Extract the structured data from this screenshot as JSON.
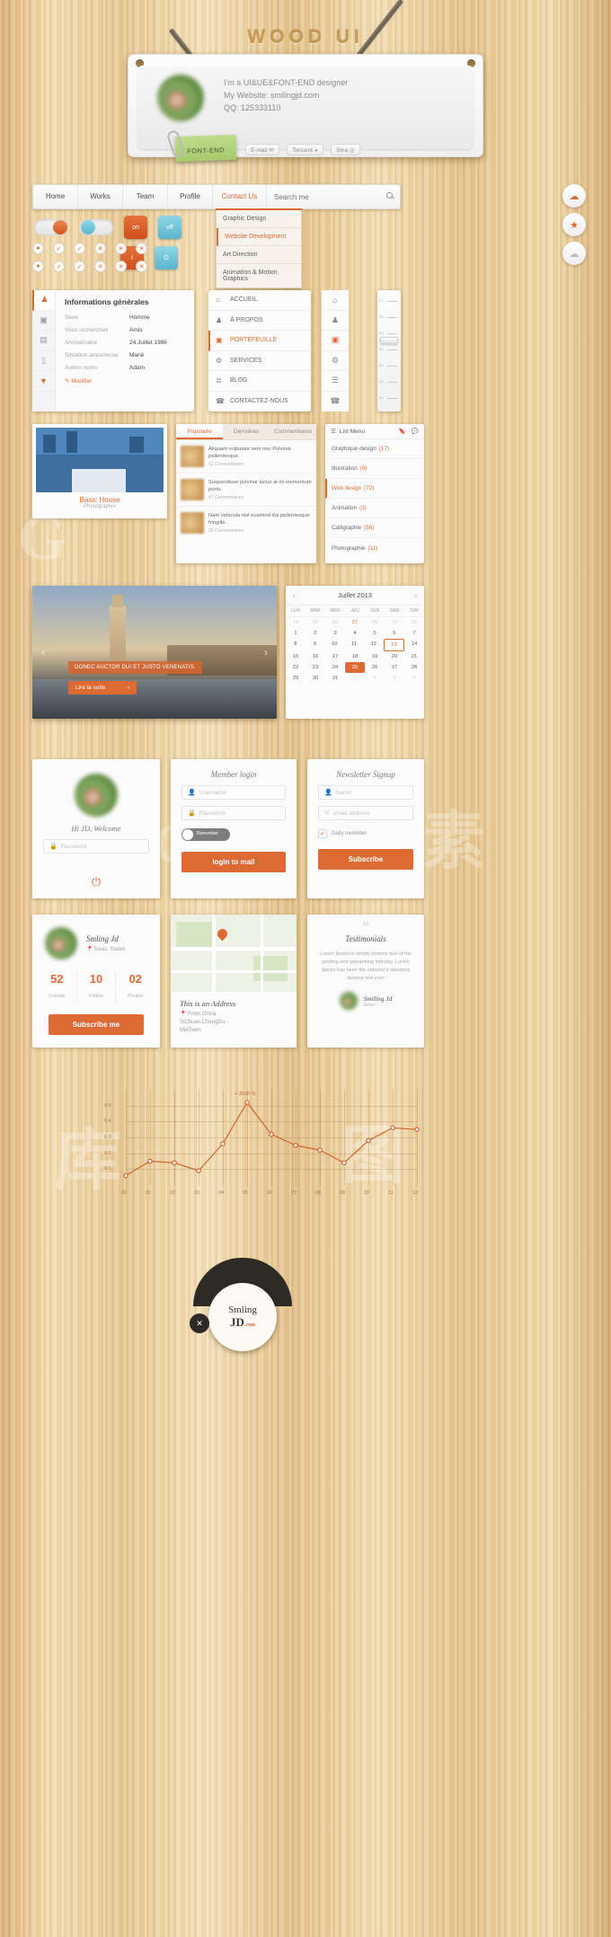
{
  "sign": {
    "wood_title": "WOOD UI",
    "lines": [
      "I'm a UI&UE&FONT-END designer",
      "My Website: smilingjd.com",
      "QQ: 125333110"
    ],
    "tag_label": "FONT-END",
    "buttons": [
      {
        "label": "E-mail",
        "icon": "mail-icon"
      },
      {
        "label": "Tencent",
        "icon": "penguin-icon"
      },
      {
        "label": "Sina",
        "icon": "weibo-icon"
      }
    ]
  },
  "nav": {
    "items": [
      {
        "label": "Home",
        "active": false
      },
      {
        "label": "Works",
        "active": false
      },
      {
        "label": "Team",
        "active": false
      },
      {
        "label": "Profile",
        "active": false
      },
      {
        "label": "Contact Us",
        "active": true
      }
    ],
    "search_placeholder": "Search me",
    "dropdown": [
      {
        "label": "Graphic Design",
        "active": false
      },
      {
        "label": "Website Development",
        "active": true
      },
      {
        "label": "Art Direction",
        "active": false
      },
      {
        "label": "Animation & Motion Graphics",
        "active": false
      }
    ]
  },
  "round_buttons": [
    {
      "icon": "cloud-upload-icon",
      "glyph": "☁"
    },
    {
      "icon": "star-icon",
      "glyph": "★"
    },
    {
      "icon": "cloud-icon",
      "glyph": "☁"
    }
  ],
  "toggles": [
    {
      "state": "on",
      "label": "on"
    },
    {
      "state": "off",
      "label": "off"
    }
  ],
  "square_buttons": [
    {
      "label": "on",
      "color": "#dd5a28"
    },
    {
      "label": "off",
      "color": "#6ec5d8"
    },
    {
      "label": "I",
      "color": "#dd5a28"
    },
    {
      "label": "O",
      "color": "#6ec5d8"
    }
  ],
  "check_grid": [
    [
      "●",
      "✓",
      "✓",
      "✕",
      "✕",
      "✕"
    ],
    [
      "●",
      "✓",
      "✓",
      "✕",
      "✕",
      "✕"
    ]
  ],
  "info_panel": {
    "title": "Informations générales",
    "rows": [
      {
        "key": "Sexe",
        "value": "Homme"
      },
      {
        "key": "Vous recherchez",
        "value": "Amis"
      },
      {
        "key": "Anniversaire",
        "value": "24 Juillet 1986"
      },
      {
        "key": "Situation amoureuse",
        "value": "Marié"
      },
      {
        "key": "Autres noms",
        "value": "Adam"
      }
    ],
    "edit_label": "Modifier",
    "rail_icons": [
      "users-icon",
      "image-icon",
      "film-icon",
      "document-icon",
      "download-icon"
    ]
  },
  "vertical_menu": {
    "items": [
      {
        "label": "ACCUEIL",
        "icon": "home-icon",
        "glyph": "⌂",
        "active": false
      },
      {
        "label": "À PROPOS",
        "icon": "users-icon",
        "glyph": "♟",
        "active": false
      },
      {
        "label": "PORTEFEUILLE",
        "icon": "briefcase-icon",
        "glyph": "▣",
        "active": true
      },
      {
        "label": "SERVICES",
        "icon": "gear-icon",
        "glyph": "⚙",
        "active": false
      },
      {
        "label": "BLOG",
        "icon": "list-icon",
        "glyph": "≣",
        "active": false
      },
      {
        "label": "CONTACTEZ-NOUS",
        "icon": "phone-icon",
        "glyph": "☎",
        "active": false
      }
    ],
    "side_icons": [
      "home-icon",
      "users-icon",
      "briefcase-icon",
      "gear-icon",
      "list-icon",
      "phone-icon"
    ]
  },
  "ruler": {
    "labels": [
      "07",
      "06",
      "05",
      "04",
      "03",
      "02",
      "01"
    ],
    "knob_position": 52
  },
  "photo_card": {
    "title": "Basic House",
    "subtitle": "Photographie"
  },
  "tabs_panel": {
    "tabs": [
      {
        "label": "Populaire",
        "active": true
      },
      {
        "label": "Dernières",
        "active": false
      },
      {
        "label": "Commentaires",
        "active": false
      }
    ],
    "posts": [
      {
        "text": "Aliquam vulputate sem nec Pulvinar pellentesque.",
        "comments": "52 Commentaires"
      },
      {
        "text": "Suspendisse pulvinar lacus at mi elementum porta.",
        "comments": "47 Commentaires"
      },
      {
        "text": "Nam vehicula nisl euismod dui pellentesque fringilla.",
        "comments": "38 Commentaires"
      }
    ]
  },
  "list_menu": {
    "header": "List Menu",
    "header_icons": [
      "bookmark-icon",
      "comment-icon"
    ],
    "items": [
      {
        "label": "Graphique design",
        "count": "(17)",
        "active": false
      },
      {
        "label": "Illustration",
        "count": "(9)",
        "active": false
      },
      {
        "label": "Web design",
        "count": "(72)",
        "active": true
      },
      {
        "label": "Animation",
        "count": "(3)",
        "active": false
      },
      {
        "label": "Calligraphie",
        "count": "(56)",
        "active": false
      },
      {
        "label": "Photographie",
        "count": "(11)",
        "active": false
      }
    ]
  },
  "banner": {
    "caption": "DONEC AUCTOR DUI ET JUSTO VENENATIS.",
    "button": "Lire la suite",
    "prev": "‹",
    "next": "›"
  },
  "calendar": {
    "month": "Juillet 2013",
    "prev": "‹",
    "next": "›",
    "dow": [
      "LUN",
      "MAR",
      "MER",
      "JEU",
      "VEN",
      "SAM",
      "DIM"
    ],
    "weeks": [
      [
        {
          "d": "24",
          "s": "mut"
        },
        {
          "d": "25",
          "s": "mut"
        },
        {
          "d": "26",
          "s": "mut"
        },
        {
          "d": "27",
          "s": "orng"
        },
        {
          "d": "28",
          "s": "mut"
        },
        {
          "d": "29",
          "s": "mut"
        },
        {
          "d": "30",
          "s": "mut"
        }
      ],
      [
        {
          "d": "1",
          "s": ""
        },
        {
          "d": "2",
          "s": ""
        },
        {
          "d": "3",
          "s": ""
        },
        {
          "d": "4",
          "s": ""
        },
        {
          "d": "5",
          "s": ""
        },
        {
          "d": "6",
          "s": ""
        },
        {
          "d": "7",
          "s": ""
        }
      ],
      [
        {
          "d": "8",
          "s": ""
        },
        {
          "d": "9",
          "s": ""
        },
        {
          "d": "10",
          "s": ""
        },
        {
          "d": "11",
          "s": ""
        },
        {
          "d": "12",
          "s": ""
        },
        {
          "d": "13",
          "s": "box"
        },
        {
          "d": "14",
          "s": ""
        }
      ],
      [
        {
          "d": "15",
          "s": ""
        },
        {
          "d": "16",
          "s": ""
        },
        {
          "d": "17",
          "s": ""
        },
        {
          "d": "18",
          "s": ""
        },
        {
          "d": "19",
          "s": ""
        },
        {
          "d": "20",
          "s": ""
        },
        {
          "d": "21",
          "s": ""
        }
      ],
      [
        {
          "d": "22",
          "s": ""
        },
        {
          "d": "23",
          "s": ""
        },
        {
          "d": "24",
          "s": ""
        },
        {
          "d": "25",
          "s": "sel"
        },
        {
          "d": "26",
          "s": ""
        },
        {
          "d": "27",
          "s": ""
        },
        {
          "d": "28",
          "s": ""
        }
      ],
      [
        {
          "d": "29",
          "s": ""
        },
        {
          "d": "30",
          "s": ""
        },
        {
          "d": "31",
          "s": ""
        },
        {
          "d": "1",
          "s": "mut"
        },
        {
          "d": "2",
          "s": "mut"
        },
        {
          "d": "3",
          "s": "mut"
        },
        {
          "d": "4",
          "s": "mut"
        }
      ]
    ]
  },
  "welcome_card": {
    "greeting": "Hi JD, Welcome",
    "password_placeholder": "Password",
    "power_icon": "power-icon"
  },
  "member_login": {
    "title": "Member login",
    "username_placeholder": "Username",
    "password_placeholder": "Password",
    "remember_label": "Remmber",
    "submit_label": "login to mail"
  },
  "newsletter": {
    "title": "Newsletter Signup",
    "name_placeholder": "Name",
    "email_placeholder": "email address",
    "checkbox_label": "Daily newletter",
    "submit_label": "Subscribe"
  },
  "profile_card": {
    "name": "Smling Jd",
    "location": "Texas, States",
    "stats": [
      {
        "value": "52",
        "label": "Friends"
      },
      {
        "value": "10",
        "label": "Follow"
      },
      {
        "value": "02",
        "label": "Photos"
      }
    ],
    "button": "Subscribe me"
  },
  "address_card": {
    "title": "This is an Address",
    "lines": [
      "From China",
      "SiChuan ChengDu",
      "MidTown"
    ]
  },
  "testimonial": {
    "title": "Testimonials",
    "body": "Lorem Ipsum is simply dummy text of the printing and typesetting industry. Lorem Ipsum has been the industry's standard dummy text ever",
    "author": "Smiling Jd",
    "role": "Actor"
  },
  "logo": {
    "top_icons": [
      "gear-icon",
      "leaf-icon",
      "cloud-icon",
      "bookmark-icon"
    ],
    "line1": "Smling",
    "line2": "JD",
    "suffix": ".com",
    "close_icon": "close-icon"
  },
  "chart_data": {
    "type": "line",
    "title": "",
    "annotation": "+ 3500 %",
    "x": [
      "00",
      "01",
      "02",
      "03",
      "04",
      "05",
      "06",
      "07",
      "08",
      "09",
      "10",
      "11",
      "12"
    ],
    "values": [
      0.06,
      0.15,
      0.14,
      0.09,
      0.26,
      0.52,
      0.32,
      0.25,
      0.22,
      0.14,
      0.28,
      0.36,
      0.35
    ],
    "ylabels": [
      "0.1",
      "0.2",
      "0.3",
      "0.4",
      "0.5"
    ],
    "ylim": [
      0,
      0.6
    ],
    "xlabel": "",
    "ylabel": "",
    "grid": true,
    "line_color": "#d4632f",
    "legend": []
  },
  "watermarks": [
    "G",
    "图",
    "素",
    "库"
  ]
}
